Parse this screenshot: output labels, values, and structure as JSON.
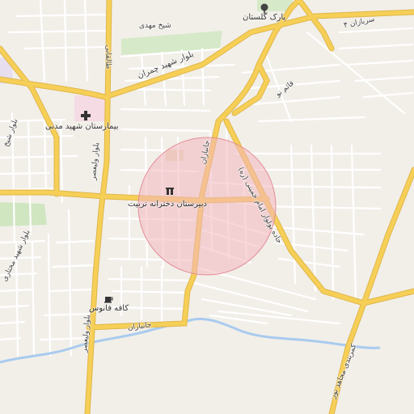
{
  "map": {
    "highlight_color": "#f3b6bd",
    "colors": {
      "background": "#f2efe9",
      "minor_road": "#ffffff",
      "major_road": "#f6cf57",
      "major_road_edge": "#e0b64a",
      "park": "#cfe6c1",
      "river": "#a9cbee",
      "hospital_area": "#f5dbe3"
    }
  },
  "labels": {
    "park_golestan": "پارک گلستان",
    "sheikh_mahdi": "شیخ مهدی",
    "sarbazan_4": "سربازان ۴",
    "taleghani": "طالقانی",
    "blvd_chamran": "بلوار شهید چمران",
    "ghaem_no": "قائم نو",
    "hospital": "بیمارستان شهید مدنی",
    "blvd_sheikh": "بلوار شیخ",
    "blvd_vali_asr_upper": "بلوار ولیعصر",
    "jannbazan_upper": "جانبازان",
    "blvd_shahid_mokhtari": "بلوار شهید مختاری",
    "girls_school": "دبیرستان دخترانه تربیت",
    "blvd_amam": "جاده بولوار امام خمینی (ره)",
    "cafe": "کافه فانوس",
    "blvd_vali_asr_lower": "بلوار ولیعصر",
    "jannbazan_lower": "جانبازان",
    "kamarbandi": "کمربندی مجاهد نور"
  },
  "icons": {
    "park": "tree-icon",
    "hospital": "hospital-cross-icon",
    "school": "school-icon",
    "cafe": "coffee-cup-icon"
  }
}
